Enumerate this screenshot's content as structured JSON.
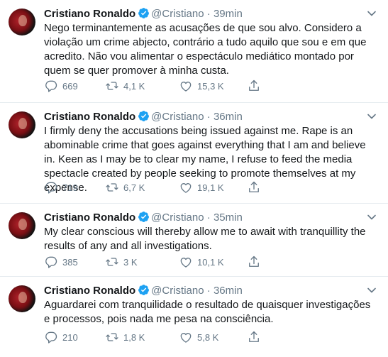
{
  "tweets": [
    {
      "name": "Cristiano Ronaldo",
      "handle": "@Cristiano",
      "separator": "·",
      "time": "39min",
      "text": "Nego terminantemente as acusações de que sou alvo. Considero a violação um crime abjecto, contrário a tudo aquilo que sou e em que acredito. Não vou alimentar o espectáculo mediático montado por quem se quer promover à minha custa.",
      "replies": "669",
      "retweets": "4,1 K",
      "likes": "15,3 K"
    },
    {
      "name": "Cristiano Ronaldo",
      "handle": "@Cristiano",
      "separator": "·",
      "time": "36min",
      "text": "I firmly deny the accusations being issued against me. Rape is an abominable crime that goes against everything that I am and believe in. Keen as I may be to clear my name, I refuse to feed the media spectacle created by people seeking to promote themselves at my expense.",
      "replies": "719",
      "retweets": "6,7 K",
      "likes": "19,1 K"
    },
    {
      "name": "Cristiano Ronaldo",
      "handle": "@Cristiano",
      "separator": "·",
      "time": "35min",
      "text": "My clear conscious will thereby allow me to await with tranquillity the results of any and all investigations.",
      "replies": "385",
      "retweets": "3 K",
      "likes": "10,1 K"
    },
    {
      "name": "Cristiano Ronaldo",
      "handle": "@Cristiano",
      "separator": "·",
      "time": "36min",
      "text": "Aguardarei com tranquilidade o resultado de quaisquer investigações e processos, pois nada me pesa na consciência.",
      "replies": "210",
      "retweets": "1,8 K",
      "likes": "5,8 K"
    }
  ],
  "colors": {
    "text": "#14171a",
    "secondary": "#657786",
    "verified": "#1da1f2",
    "divider": "#e6ecf0"
  },
  "icons": [
    "verified-badge-icon",
    "chevron-down-icon",
    "reply-icon",
    "retweet-icon",
    "like-icon",
    "share-icon"
  ]
}
